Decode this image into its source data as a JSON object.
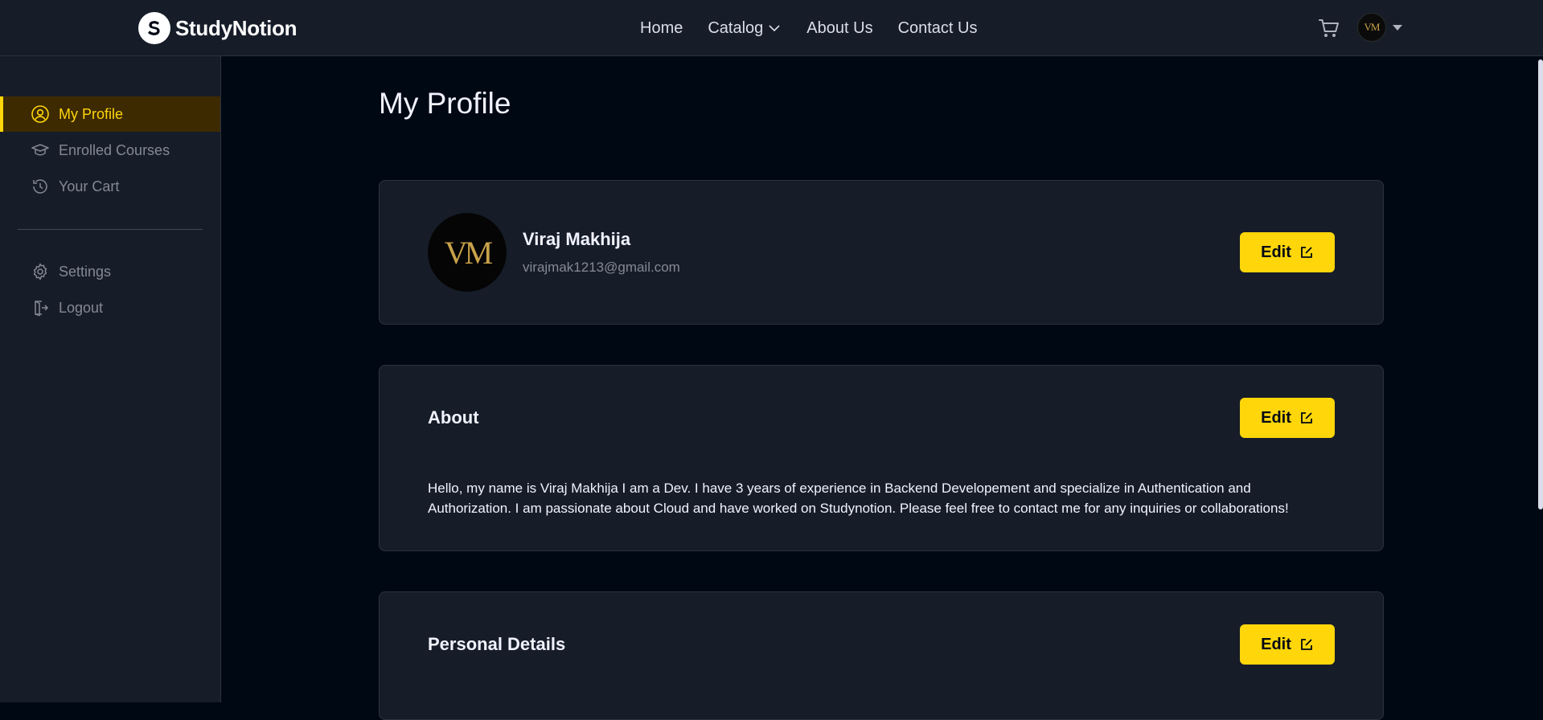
{
  "brand": {
    "name": "StudyNotion"
  },
  "nav": {
    "links": [
      "Home",
      "Catalog",
      "About Us",
      "Contact Us"
    ]
  },
  "header": {
    "avatar_initials": "VM"
  },
  "sidebar": {
    "items": [
      {
        "label": "My Profile",
        "icon": "user-circle-icon",
        "active": true
      },
      {
        "label": "Enrolled Courses",
        "icon": "graduation-cap-icon",
        "active": false
      },
      {
        "label": "Your Cart",
        "icon": "history-icon",
        "active": false
      }
    ],
    "settings_label": "Settings",
    "logout_label": "Logout"
  },
  "page": {
    "title": "My Profile"
  },
  "profile": {
    "avatar_initials": "VM",
    "name": "Viraj Makhija",
    "email": "virajmak1213@gmail.com",
    "edit_label": "Edit"
  },
  "about": {
    "heading": "About",
    "edit_label": "Edit",
    "text": "Hello, my name is Viraj Makhija I am a Dev. I have 3 years of experience in Backend Developement and specialize in Authentication and Authorization. I am passionate about Cloud and have worked on Studynotion. Please feel free to contact me for any inquiries or collaborations!"
  },
  "personal": {
    "heading": "Personal Details",
    "edit_label": "Edit"
  },
  "colors": {
    "accent": "#FFD60A",
    "background": "#000814",
    "panel": "#161D29",
    "active_bg": "#3D2A01"
  }
}
